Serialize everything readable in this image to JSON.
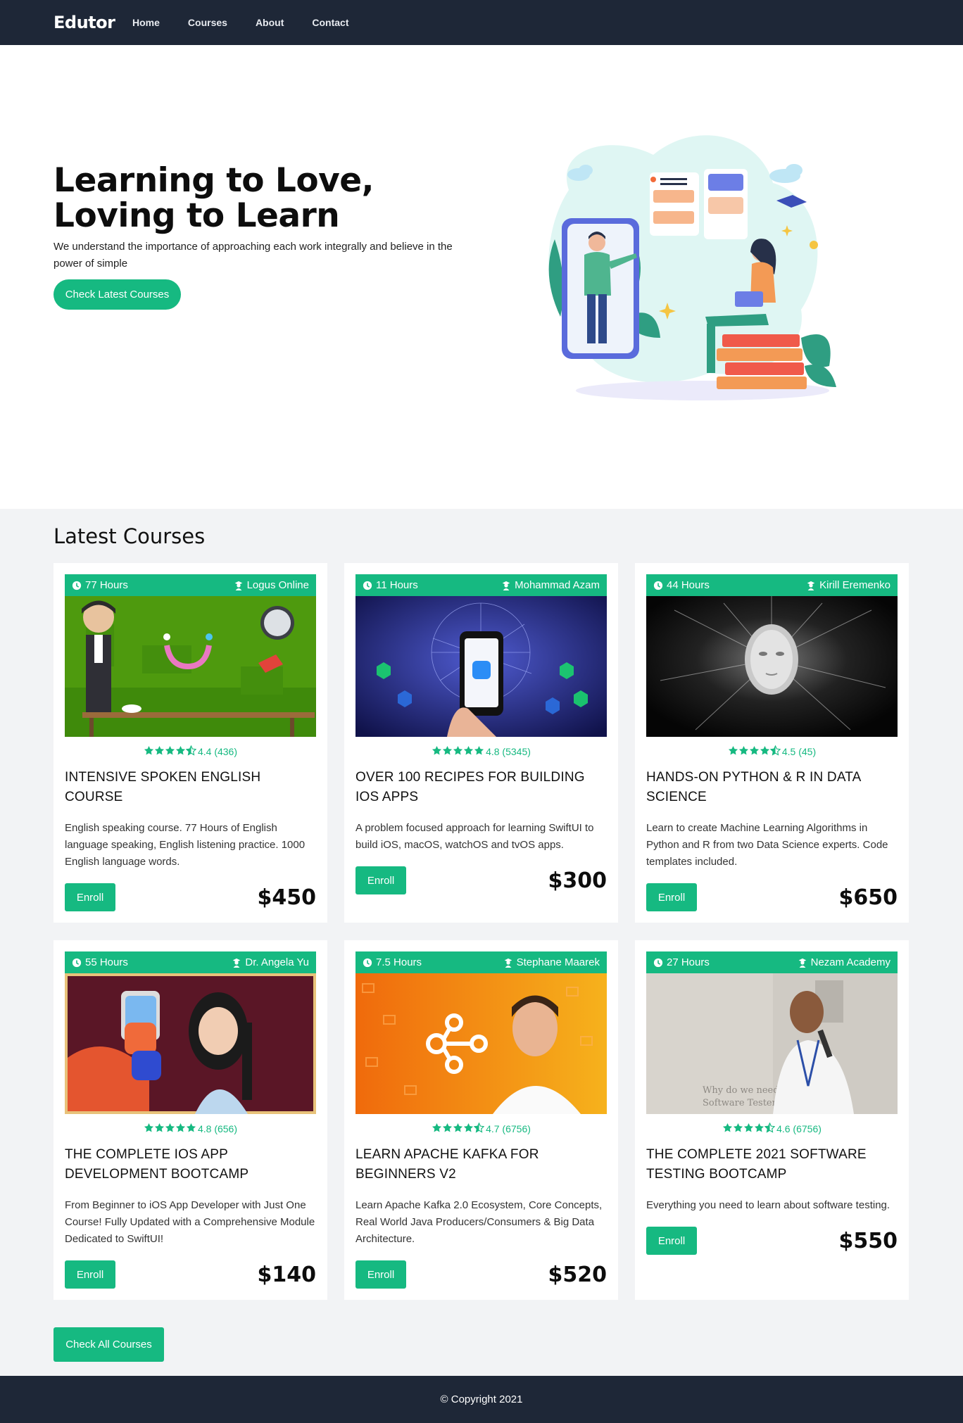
{
  "brand": "Edutor",
  "nav": [
    "Home",
    "Courses",
    "About",
    "Contact"
  ],
  "hero": {
    "title_line1": "Learning to Love,",
    "title_line2": "Loving to Learn",
    "subtitle": "We understand the importance of approaching each work integrally and believe in the power of simple",
    "cta": "Check Latest Courses"
  },
  "section_title": "Latest Courses",
  "courses": [
    {
      "hours": "77 Hours",
      "author": "Logus Online",
      "rating": "4.4 (436)",
      "stars": 4.4,
      "title": "INTENSIVE SPOKEN ENGLISH COURSE",
      "desc": "English speaking course. 77 Hours of English language speaking, English listening practice. 1000 English language words.",
      "price": "$450",
      "enroll": "Enroll"
    },
    {
      "hours": "11 Hours",
      "author": "Mohammad Azam",
      "rating": "4.8 (5345)",
      "stars": 4.8,
      "title": "OVER 100 RECIPES FOR BUILDING IOS APPS",
      "desc": "A problem focused approach for learning SwiftUI to build iOS, macOS, watchOS and tvOS apps.",
      "price": "$300",
      "enroll": "Enroll"
    },
    {
      "hours": "44 Hours",
      "author": "Kirill Eremenko",
      "rating": "4.5 (45)",
      "stars": 4.5,
      "title": "HANDS-ON PYTHON & R IN DATA SCIENCE",
      "desc": "Learn to create Machine Learning Algorithms in Python and R from two Data Science experts. Code templates included.",
      "price": "$650",
      "enroll": "Enroll"
    },
    {
      "hours": "55 Hours",
      "author": "Dr. Angela Yu",
      "rating": "4.8 (656)",
      "stars": 4.8,
      "title": "THE COMPLETE IOS APP DEVELOPMENT BOOTCAMP",
      "desc": "From Beginner to iOS App Developer with Just One Course! Fully Updated with a Comprehensive Module Dedicated to SwiftUI!",
      "price": "$140",
      "enroll": "Enroll"
    },
    {
      "hours": "7.5 Hours",
      "author": "Stephane Maarek",
      "rating": "4.7 (6756)",
      "stars": 4.7,
      "title": "LEARN APACHE KAFKA FOR BEGINNERS V2",
      "desc": "Learn Apache Kafka 2.0 Ecosystem, Core Concepts, Real World Java Producers/Consumers & Big Data Architecture.",
      "price": "$520",
      "enroll": "Enroll"
    },
    {
      "hours": "27 Hours",
      "author": "Nezam Academy",
      "rating": "4.6 (6756)",
      "stars": 4.6,
      "title": "THE COMPLETE 2021 SOFTWARE TESTING BOOTCAMP",
      "desc": "Everything you need to learn about software testing.",
      "price": "$550",
      "enroll": "Enroll"
    }
  ],
  "image_text": {
    "testing_line1": "Why do we need",
    "testing_line2": "Software Testers"
  },
  "check_all": "Check All Courses",
  "footer": "© Copyright 2021",
  "colors": {
    "accent": "#16b981",
    "navbar": "#1e2737",
    "section_bg": "#f2f3f5"
  }
}
